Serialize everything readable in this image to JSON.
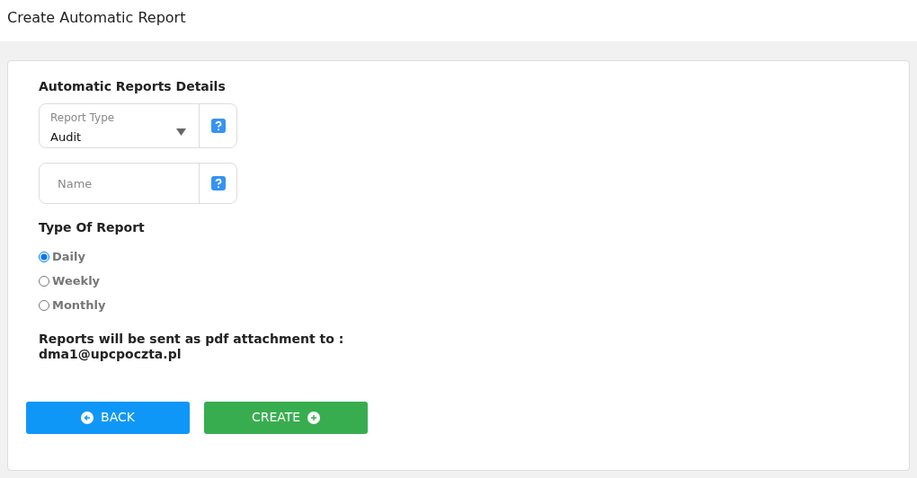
{
  "page_title": "Create Automatic Report",
  "section_title": "Automatic Reports Details",
  "report_type": {
    "label": "Report Type",
    "value": "Audit"
  },
  "name_field": {
    "placeholder": "Name"
  },
  "type_title": "Type Of Report",
  "report_options": [
    {
      "label": "Daily",
      "selected": true
    },
    {
      "label": "Weekly",
      "selected": false
    },
    {
      "label": "Monthly",
      "selected": false
    }
  ],
  "note": "Reports will be sent as pdf attachment to :",
  "email": "dma1@upcpoczta.pl",
  "buttons": [
    {
      "kind": "back",
      "label": "BACK"
    },
    {
      "kind": "create",
      "label": "CREATE"
    }
  ]
}
